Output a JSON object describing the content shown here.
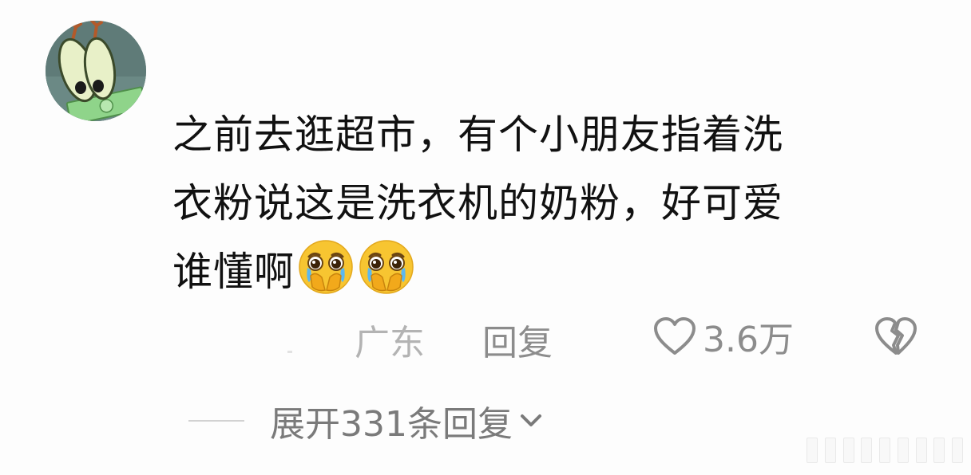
{
  "comment": {
    "avatar_icon": "cartoon-eyes-money-avatar",
    "text_lines": [
      "之前去逛超市，有个小朋友指着洗",
      "衣粉说这是洗衣机的奶粉，好可爱",
      "谁懂啊"
    ],
    "emojis": [
      "pleading-face-hands-over-mouth-emoji",
      "pleading-face-hands-over-mouth-emoji"
    ],
    "location": "广东",
    "reply_label": "回复",
    "like_icon": "heart-outline-icon",
    "like_count": "3.6万",
    "dislike_icon": "broken-heart-icon"
  },
  "replies": {
    "expand_label": "展开331条回复",
    "expand_icon": "chevron-down-icon"
  },
  "colors": {
    "text": "#111111",
    "meta": "#8c8c8c",
    "location": "#b3b3b3",
    "emoji_face": "#f7c531"
  }
}
